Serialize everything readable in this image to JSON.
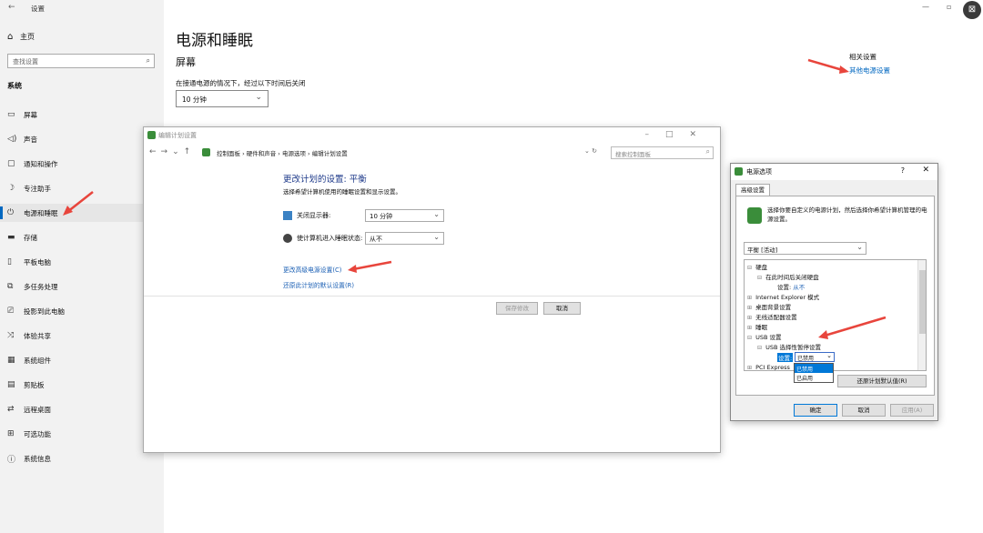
{
  "settings": {
    "title": "设置",
    "home": "主页",
    "search_placeholder": "查找设置",
    "section": "系统",
    "nav": [
      {
        "label": "屏幕",
        "icon": "monitor-icon"
      },
      {
        "label": "声音",
        "icon": "speaker-icon"
      },
      {
        "label": "通知和操作",
        "icon": "notification-icon"
      },
      {
        "label": "专注助手",
        "icon": "moon-icon"
      },
      {
        "label": "电源和睡眠",
        "icon": "power-icon",
        "active": true
      },
      {
        "label": "存储",
        "icon": "storage-icon"
      },
      {
        "label": "平板电脑",
        "icon": "tablet-icon"
      },
      {
        "label": "多任务处理",
        "icon": "multitask-icon"
      },
      {
        "label": "投影到此电脑",
        "icon": "project-icon"
      },
      {
        "label": "体验共享",
        "icon": "share-icon"
      },
      {
        "label": "系统组件",
        "icon": "components-icon"
      },
      {
        "label": "剪贴板",
        "icon": "clipboard-icon"
      },
      {
        "label": "远程桌面",
        "icon": "remote-icon"
      },
      {
        "label": "可选功能",
        "icon": "features-icon"
      },
      {
        "label": "系统信息",
        "icon": "info-icon"
      }
    ],
    "page_title": "电源和睡眠",
    "screen_heading": "屏幕",
    "screen_label": "在接通电源的情况下，经过以下时间后关闭",
    "screen_value": "10 分钟",
    "related_heading": "相关设置",
    "related_link": "其他电源设置"
  },
  "control_panel": {
    "title": "编辑计划设置",
    "breadcrumb": [
      "控制面板",
      "硬件和声音",
      "电源选项",
      "编辑计划设置"
    ],
    "search_placeholder": "搜索控制面板",
    "heading": "更改计划的设置: 平衡",
    "subheading": "选择希望计算机使用的睡眠设置和显示设置。",
    "display_label": "关闭显示器:",
    "display_value": "10 分钟",
    "sleep_label": "使计算机进入睡眠状态:",
    "sleep_value": "从不",
    "advanced_link": "更改高级电源设置(C)",
    "restore_link": "还原此计划的默认设置(R)",
    "save_button": "保存修改",
    "cancel_button": "取消"
  },
  "power_options": {
    "title": "电源选项",
    "help": "?",
    "tab": "高级设置",
    "description": "选择你要自定义的电源计划，然后选择你希望计算机管理的电源设置。",
    "plan": "平衡 [活动]",
    "tree": {
      "hard_disk": "硬盘",
      "hd_after": "在此时间后关闭硬盘",
      "hd_setting": "设置:",
      "hd_value": "从不",
      "ie": "Internet Explorer 模式",
      "desktop_bg": "桌面背景设置",
      "wireless": "无线适配器设置",
      "sleep": "睡眠",
      "usb": "USB 设置",
      "usb_suspend": "USB 选择性暂停设置",
      "usb_setting": "设置:",
      "usb_value": "已禁用",
      "pci": "PCI Express"
    },
    "dropdown_options": [
      "已禁用",
      "已启用"
    ],
    "restore_button": "还原计划默认值(R)",
    "ok": "确定",
    "cancel": "取消",
    "apply": "应用(A)"
  },
  "colors": {
    "accent": "#0067c0",
    "annotation": "#e8453c"
  }
}
